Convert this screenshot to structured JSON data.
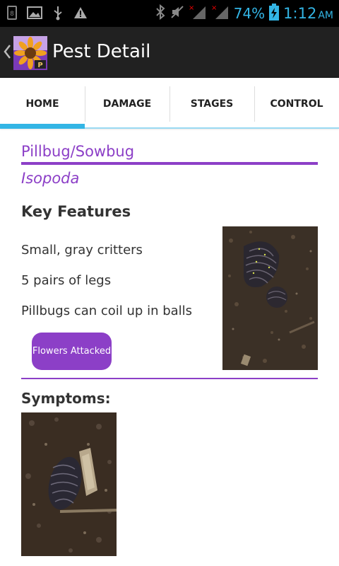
{
  "status_bar": {
    "battery": "74%",
    "time": "1:12",
    "ampm": "AM"
  },
  "action_bar": {
    "title": "Pest Detail"
  },
  "tabs": [
    {
      "label": "HOME",
      "active": true
    },
    {
      "label": "DAMAGE",
      "active": false
    },
    {
      "label": "STAGES",
      "active": false
    },
    {
      "label": "CONTROL",
      "active": false
    }
  ],
  "pest": {
    "common_name": "Pillbug/Sowbug",
    "scientific_name": "Isopoda"
  },
  "key_features": {
    "title": "Key Features",
    "items": [
      "Small, gray critters",
      "5 pairs of legs",
      "Pillbugs can coil up in balls"
    ],
    "button_label": "Flowers Attacked"
  },
  "symptoms": {
    "title": "Symptoms:"
  },
  "colors": {
    "accent_purple": "#8c3fc7",
    "tab_blue": "#33b5e5",
    "action_bar": "#212121"
  }
}
